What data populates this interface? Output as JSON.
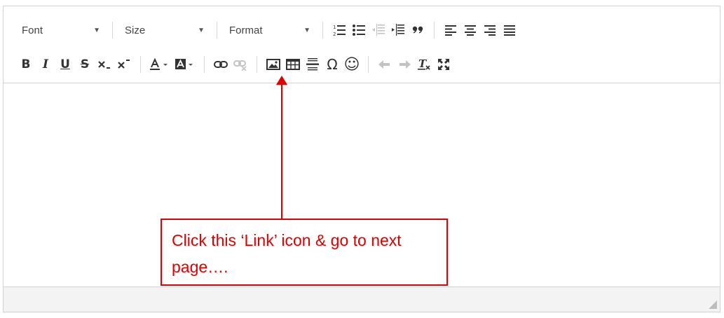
{
  "toolbar": {
    "font_label": "Font",
    "size_label": "Size",
    "format_label": "Format",
    "buttons_row1": [
      "numbered-list",
      "bulleted-list",
      "outdent",
      "indent",
      "blockquote",
      "align-left",
      "align-center",
      "align-right",
      "align-justify"
    ],
    "buttons_row2": [
      "bold",
      "italic",
      "underline",
      "strikethrough",
      "subscript",
      "superscript",
      "text-color",
      "background-color",
      "link",
      "unlink",
      "image",
      "table",
      "horizontal-line",
      "special-character",
      "smiley",
      "undo",
      "redo",
      "remove-format",
      "maximize"
    ],
    "glyphs": {
      "bold": "B",
      "italic": "I",
      "underline": "U",
      "strike": "S",
      "omega": "Ω",
      "smiley": "☺"
    }
  },
  "annotation": {
    "text": "Click this ‘Link’ icon & go to next page….",
    "color": "#e00000"
  },
  "colors": {
    "border": "#d1d1d1",
    "statusbar_bg": "#f3f3f3",
    "icon": "#333333",
    "icon_disabled": "#c3c3c3"
  }
}
